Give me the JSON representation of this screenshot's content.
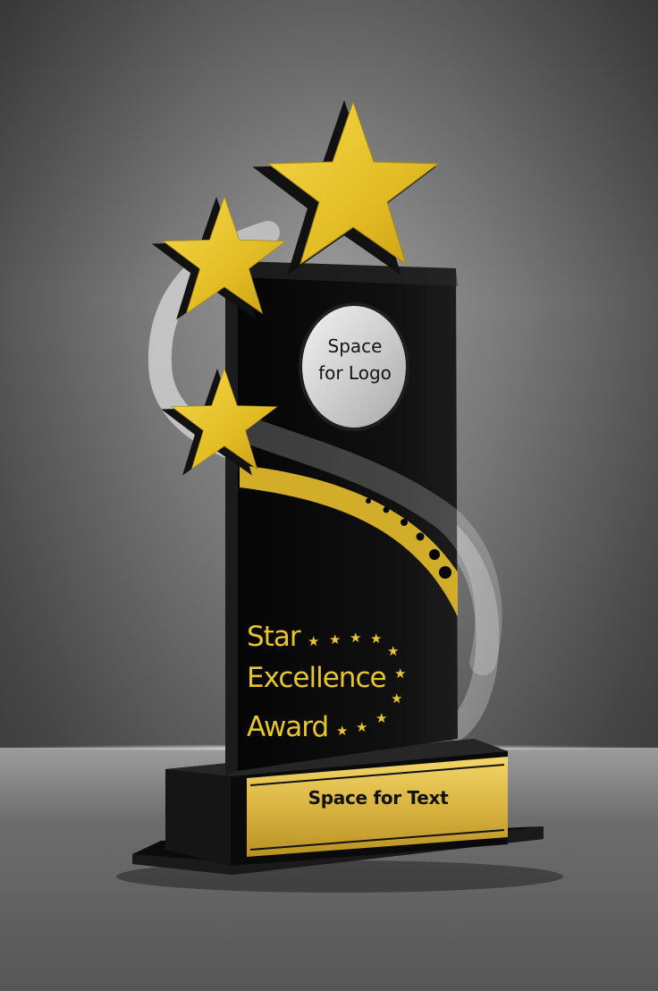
{
  "logo_disc": {
    "text_line_1": "Space",
    "text_line_2": "for Logo"
  },
  "award_title": {
    "line_1": "Star",
    "line_2": "Excellence",
    "line_3": "Award"
  },
  "base_plate": {
    "text": "Space for Text"
  },
  "colors": {
    "gold": "#e8c52e",
    "acrylic_black": "#0a0a0a",
    "silver": "#cfcfcf",
    "background": "#7a7a7a"
  }
}
